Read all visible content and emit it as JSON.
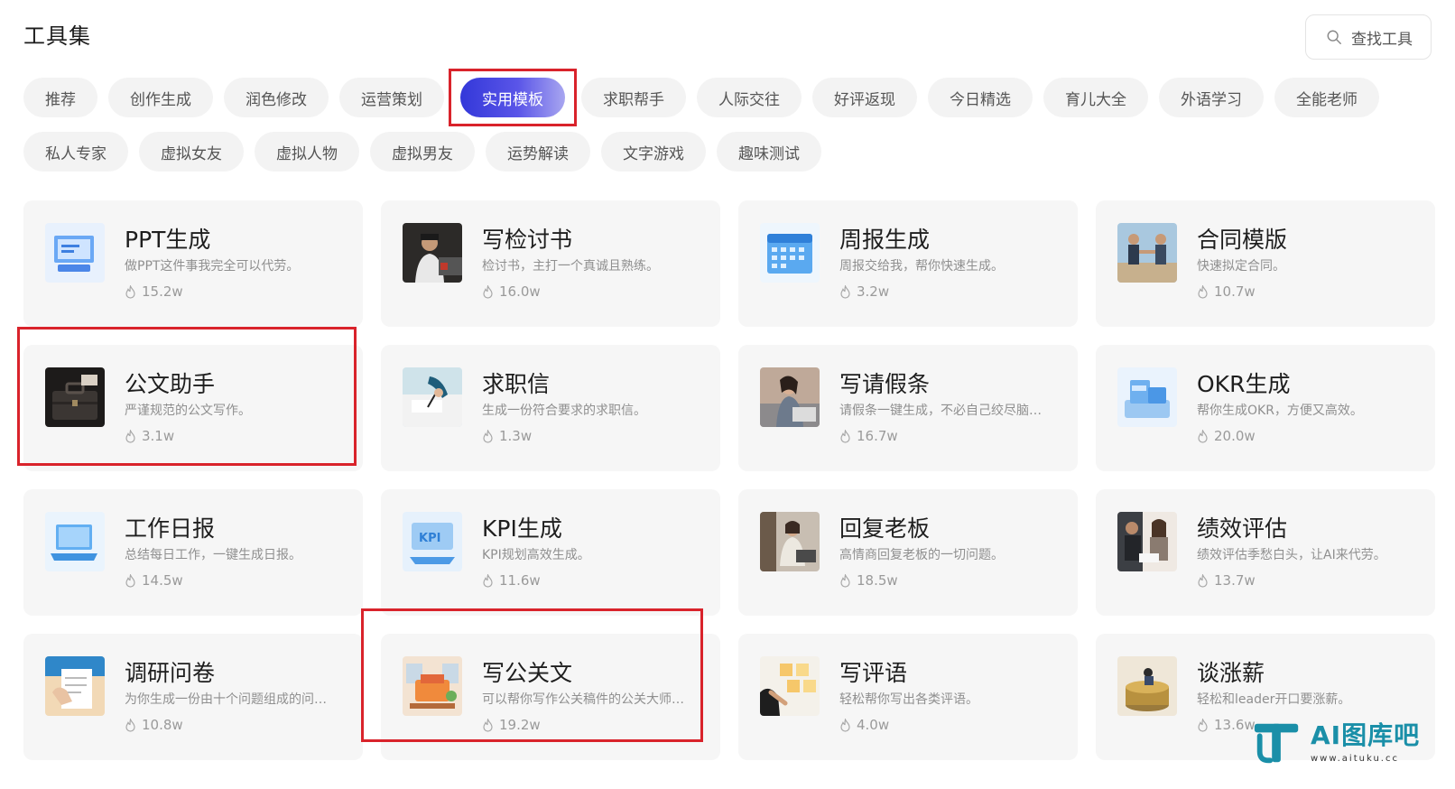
{
  "header": {
    "title": "工具集",
    "search_label": "查找工具",
    "search_icon": "search-icon"
  },
  "tabs_row1": [
    {
      "label": "推荐"
    },
    {
      "label": "创作生成"
    },
    {
      "label": "润色修改"
    },
    {
      "label": "运营策划"
    },
    {
      "label": "实用模板",
      "active": true
    },
    {
      "label": "求职帮手"
    },
    {
      "label": "人际交往"
    },
    {
      "label": "好评返现"
    },
    {
      "label": "今日精选"
    },
    {
      "label": "育儿大全"
    },
    {
      "label": "外语学习"
    },
    {
      "label": "全能老师"
    }
  ],
  "tabs_row2": [
    {
      "label": "私人专家"
    },
    {
      "label": "虚拟女友"
    },
    {
      "label": "虚拟人物"
    },
    {
      "label": "虚拟男友"
    },
    {
      "label": "运势解读"
    },
    {
      "label": "文字游戏"
    },
    {
      "label": "趣味测试"
    }
  ],
  "cards": [
    {
      "title": "PPT生成",
      "desc": "做PPT这件事我完全可以代劳。",
      "usage": "15.2w",
      "icon": "ppt-thumbnail"
    },
    {
      "title": "写检讨书",
      "desc": "检讨书，主打一个真诚且熟练。",
      "usage": "16.0w",
      "icon": "person-laptop-thumbnail"
    },
    {
      "title": "周报生成",
      "desc": "周报交给我，帮你快速生成。",
      "usage": "3.2w",
      "icon": "calendar-thumbnail"
    },
    {
      "title": "合同模版",
      "desc": "快速拟定合同。",
      "usage": "10.7w",
      "icon": "handshake-thumbnail"
    },
    {
      "title": "公文助手",
      "desc": "严谨规范的公文写作。",
      "usage": "3.1w",
      "icon": "briefcase-thumbnail"
    },
    {
      "title": "求职信",
      "desc": "生成一份符合要求的求职信。",
      "usage": "1.3w",
      "icon": "writing-hand-thumbnail"
    },
    {
      "title": "写请假条",
      "desc": "请假条一键生成，不必自己绞尽脑…",
      "usage": "16.7w",
      "icon": "tired-woman-thumbnail"
    },
    {
      "title": "OKR生成",
      "desc": "帮你生成OKR，方便又高效。",
      "usage": "20.0w",
      "icon": "okr-thumbnail"
    },
    {
      "title": "工作日报",
      "desc": "总结每日工作，一键生成日报。",
      "usage": "14.5w",
      "icon": "laptop-thumbnail"
    },
    {
      "title": "KPI生成",
      "desc": "KPI规划高效生成。",
      "usage": "11.6w",
      "icon": "kpi-thumbnail"
    },
    {
      "title": "回复老板",
      "desc": "高情商回复老板的一切问题。",
      "usage": "18.5w",
      "icon": "office-woman-thumbnail"
    },
    {
      "title": "绩效评估",
      "desc": "绩效评估季愁白头，让AI来代劳。",
      "usage": "13.7w",
      "icon": "meeting-thumbnail"
    },
    {
      "title": "调研问卷",
      "desc": "为你生成一份由十个问题组成的问…",
      "usage": "10.8w",
      "icon": "survey-thumbnail"
    },
    {
      "title": "写公关文",
      "desc": "可以帮你写作公关稿件的公关大师…",
      "usage": "19.2w",
      "icon": "pr-office-thumbnail"
    },
    {
      "title": "写评语",
      "desc": "轻松帮你写出各类评语。",
      "usage": "4.0w",
      "icon": "sticky-notes-thumbnail"
    },
    {
      "title": "谈涨薪",
      "desc": "轻松和leader开口要涨薪。",
      "usage": "13.6w",
      "icon": "coins-thumbnail"
    }
  ],
  "watermark": {
    "brand": "AI图库吧",
    "url": "www.aituku.cc"
  },
  "colors": {
    "active_tab_start": "#3338d9",
    "active_tab_end": "#a8a6f0",
    "highlight": "#d9232b",
    "card_bg": "#f6f6f6",
    "tab_bg": "#f3f3f3"
  }
}
